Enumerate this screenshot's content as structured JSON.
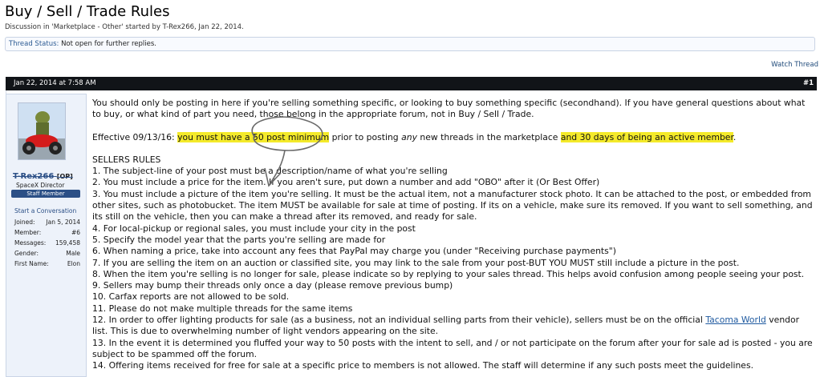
{
  "thread": {
    "title": "Buy / Sell / Trade Rules",
    "byline": "Discussion in 'Marketplace - Other' started by T-Rex266, Jan 22, 2014.",
    "status_label": "Thread Status:",
    "status_value": "Not open for further replies.",
    "watch_label": "Watch Thread"
  },
  "post": {
    "date": "Jan 22, 2014 at 7:58 AM",
    "number": "#1"
  },
  "user": {
    "name": "T-Rex266",
    "op_tag": "[OP]",
    "title": "SpaceX Director",
    "badge": "Staff Member",
    "start_conversation": "Start a Conversation",
    "stats": [
      {
        "label": "Joined:",
        "value": "Jan 5, 2014"
      },
      {
        "label": "Member:",
        "value": "#6"
      },
      {
        "label": "Messages:",
        "value": "159,458"
      },
      {
        "label": "Gender:",
        "value": "Male"
      },
      {
        "label": "First Name:",
        "value": "Elon"
      }
    ]
  },
  "body": {
    "intro": "You should only be posting in here if you're selling something specific, or looking to buy something specific (secondhand). If you have general questions about what to buy, or what kind of part you need, those belong in the appropriate forum, not in Buy / Sell / Trade.",
    "effective_prefix": "Effective 09/13/16:",
    "effective_hl1": "you must have a 50 post minimum",
    "effective_mid1": "prior to posting",
    "effective_any": "any",
    "effective_mid2": "new threads in the marketplace",
    "effective_hl2": "and 30 days of being an active member",
    "effective_end": ".",
    "heading": "SELLERS RULES",
    "rules": [
      "1. The subject-line of your post must be a description/name of what you're selling",
      "2. You must include a price for the item. If you aren't sure, put down a number and add \"OBO\" after it (Or Best Offer)",
      "3. You must include a picture of the item you're selling. It must be the actual item, not a manufacturer stock photo. It can be attached to the post, or embedded from other sites, such as photobucket. The item MUST be available for sale at time of posting. If its on a vehicle, make sure its removed. If you want to sell something, and its still on the vehicle, then you can make a thread after its removed, and ready for sale.",
      "4. For local-pickup or regional sales, you must include your city in the post",
      "5. Specify the model year that the parts you're selling are made for",
      "6. When naming a price, take into account any fees that PayPal may charge you (under \"Receiving purchase payments\")",
      "7. If you are selling the item on an auction or classified site, you may link to the sale from your post-BUT YOU MUST still include a picture in the post.",
      "8. When the item you're selling is no longer for sale, please indicate so by replying to your sales thread. This helps avoid confusion among people seeing your post.",
      "9. Sellers may bump their threads only once a day (please remove previous bump)",
      "10. Carfax reports are not allowed to be sold.",
      "11. Please do not make multiple threads for the same items"
    ],
    "rule12_prefix": "12. In order to offer lighting products for sale (as a business, not an individual selling parts from their vehicle), sellers must be on the official",
    "rule12_link": "Tacoma World",
    "rule12_suffix": "vendor list. This is due to overwhelming number of light vendors appearing on the site.",
    "rule13": "13. In the event it is determined you fluffed your way to 50 posts with the intent to sell, and / or not participate on the forum after your for sale ad is posted - you are subject to be spammed off the forum.",
    "rule14": "14. Offering items received for free for sale at a specific price to members is not allowed. The staff will determine if any such posts meet the guidelines."
  },
  "colors": {
    "highlight": "#f4ea2a",
    "header_bar": "#111418",
    "username": "#2b4f86"
  }
}
